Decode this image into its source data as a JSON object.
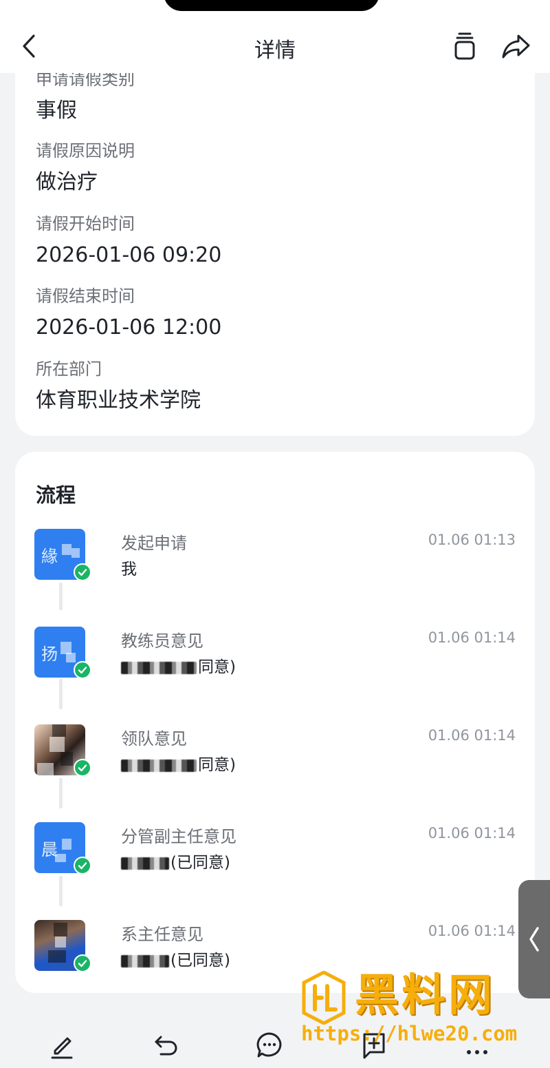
{
  "header": {
    "title": "详情",
    "back_icon": "chevron-left-icon",
    "stack_icon": "stack-icon",
    "share_icon": "share-icon"
  },
  "details": {
    "fields": [
      {
        "label": "申请请假类别",
        "value": "事假"
      },
      {
        "label": "请假原因说明",
        "value": "做治疗"
      },
      {
        "label": "请假开始时间",
        "value": "2026-01-06 09:20"
      },
      {
        "label": "请假结束时间",
        "value": "2026-01-06 12:00"
      },
      {
        "label": "所在部门",
        "value": "体育职业技术学院"
      }
    ]
  },
  "flow": {
    "title": "流程",
    "steps": [
      {
        "name": "发起申请",
        "person": "我",
        "time": "01.06 01:13"
      },
      {
        "name": "教练员意见",
        "person": "同意)",
        "time": "01.06 01:14"
      },
      {
        "name": "领队意见",
        "person": "同意)",
        "time": "01.06 01:14"
      },
      {
        "name": "分管副主任意见",
        "person": "(已同意)",
        "time": "01.06 01:14"
      },
      {
        "name": "系主任意见",
        "person": "(已同意)",
        "time": "01.06 01:14"
      }
    ],
    "avatar_chars": [
      "緣",
      "扬",
      "",
      "晨",
      ""
    ]
  },
  "toolbar": {
    "items": [
      "edit-icon",
      "undo-icon",
      "comment-icon",
      "add-icon",
      "more-icon"
    ]
  },
  "watermark": {
    "brand": "黑料网",
    "url": "https://hlwe20.com"
  },
  "colors": {
    "accent": "#2f7ff0",
    "success": "#18b566",
    "watermark": "#f6ae0b"
  }
}
